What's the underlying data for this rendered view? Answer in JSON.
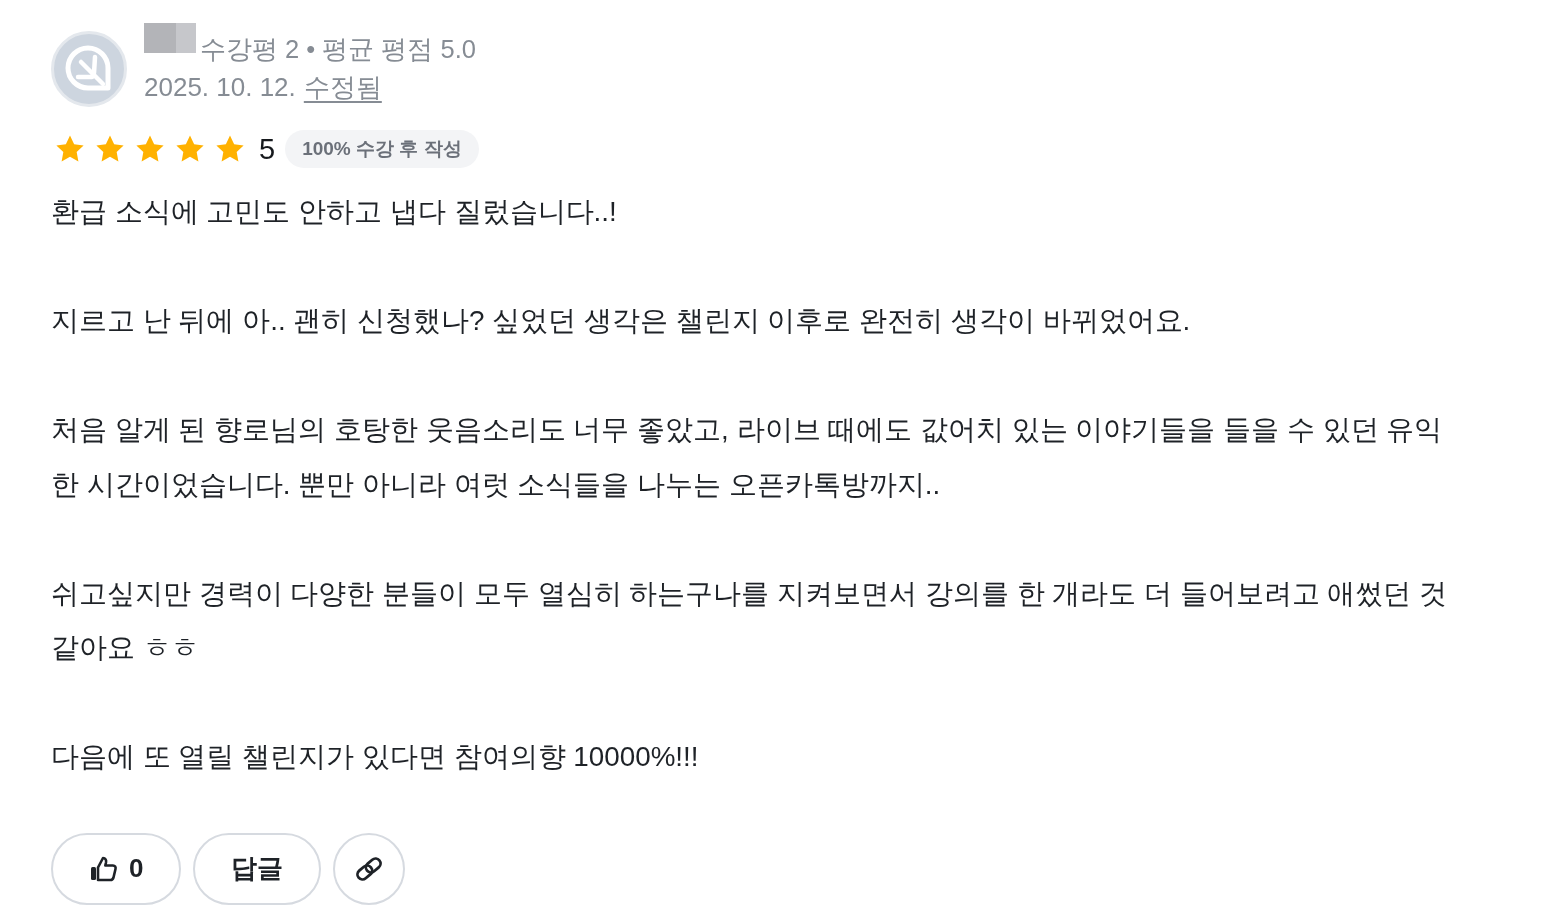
{
  "review": {
    "stats": "수강평 2 • 평균 평점 5.0",
    "date": "2025. 10. 12.",
    "edited_label": "수정됨",
    "stars": 5,
    "rating": "5",
    "badge": "100% 수강 후 작성",
    "paragraphs": [
      "환급 소식에 고민도 안하고 냅다 질렀습니다..!",
      "지르고 난 뒤에 아.. 괜히 신청했나? 싶었던 생각은 챌린지 이후로 완전히 생각이 바뀌었어요.",
      "처음 알게 된 향로님의 호탕한 웃음소리도 너무 좋았고, 라이브 때에도 값어치 있는 이야기들을 들을 수 있던 유익한 시간이었습니다. 뿐만 아니라 여럿 소식들을 나누는 오픈카톡방까지..",
      "쉬고싶지만 경력이 다양한 분들이 모두 열심히 하는구나를 지켜보면서 강의를 한 개라도 더 들어보려고 애썼던 것 같아요 ㅎㅎ",
      "다음에 또 열릴 챌린지가 있다면 참여의향 10000%!!!"
    ],
    "actions": [
      {
        "kind": "like",
        "count": "0"
      },
      {
        "kind": "reply",
        "label": "답글"
      },
      {
        "kind": "link"
      }
    ]
  }
}
